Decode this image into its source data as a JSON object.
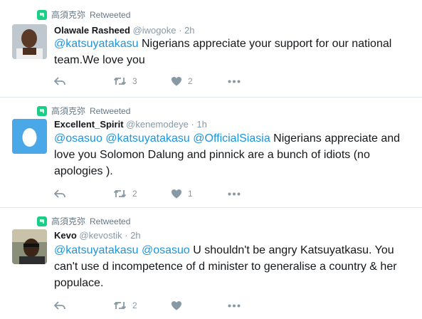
{
  "tweets": [
    {
      "retweeter": "高須克弥",
      "retweet_label": "Retweeted",
      "name": "Olawale Rasheed",
      "handle": "@iwogoke",
      "dot": "·",
      "time": "2h",
      "mentions": [
        "@katsuyatakasu"
      ],
      "text_line1": " Nigerians appreciate your support for our national",
      "text_line2": "team.We love you",
      "text_line3": "",
      "retweets": "3",
      "likes": "2"
    },
    {
      "retweeter": "高須克弥",
      "retweet_label": "Retweeted",
      "name": "Excellent_Spirit",
      "handle": "@kenemodeye",
      "dot": "·",
      "time": "1h",
      "mentions": [
        "@osasuo",
        "@katsuyatakasu",
        "@OfficialSiasia"
      ],
      "text_line1": " Nigerians appreciate and",
      "text_line2": "love you Solomon Dalung and pinnick are a bunch of idiots (no",
      "text_line3": "apologies ).",
      "retweets": "2",
      "likes": "1"
    },
    {
      "retweeter": "高須克弥",
      "retweet_label": "Retweeted",
      "name": "Kevo",
      "handle": "@kevostik",
      "dot": "·",
      "time": "2h",
      "mentions": [
        "@katsuyatakasu",
        "@osasuo"
      ],
      "text_line1": " U shouldn't be angry Katsuyatkasu. You",
      "text_line2": "can't use d incompetence of d minister to generalise a country & her",
      "text_line3": "populace.",
      "retweets": "2",
      "likes": ""
    }
  ],
  "colors": {
    "link": "#1b95e0",
    "retweet_badge": "#19cf86",
    "muted": "#8899a6"
  },
  "icons": [
    "retweet-badge-icon",
    "reply-icon",
    "retweet-icon",
    "like-icon",
    "more-icon",
    "egg-avatar-icon"
  ]
}
